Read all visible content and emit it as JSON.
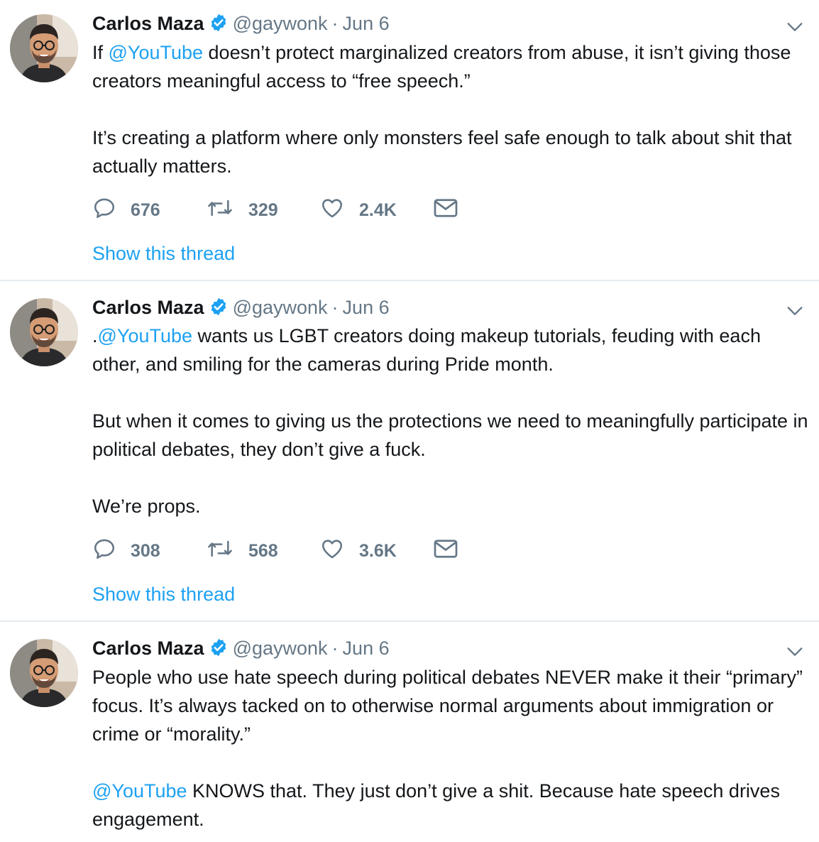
{
  "tweets": [
    {
      "name": "Carlos Maza",
      "handle": "@gaywonk",
      "separator": "·",
      "date": "Jun 6",
      "paragraphs": [
        [
          {
            "t": "If "
          },
          {
            "t": "@YouTube",
            "m": true
          },
          {
            "t": " doesn’t protect marginalized creators from abuse, it isn’t giving those creators meaningful access to “free speech.”"
          }
        ],
        [
          {
            "t": "It’s creating a platform where only monsters feel safe enough to talk about shit that actually matters."
          }
        ]
      ],
      "replies": "676",
      "retweets": "329",
      "likes": "2.4K",
      "show_thread": "Show this thread"
    },
    {
      "name": "Carlos Maza",
      "handle": "@gaywonk",
      "separator": "·",
      "date": "Jun 6",
      "paragraphs": [
        [
          {
            "t": "."
          },
          {
            "t": "@YouTube",
            "m": true
          },
          {
            "t": " wants us LGBT creators doing makeup tutorials, feuding with each other, and smiling for the cameras during Pride month."
          }
        ],
        [
          {
            "t": "But when it comes to giving us the protections we need to meaningfully participate in political debates, they don’t give a fuck."
          }
        ],
        [
          {
            "t": "We’re props."
          }
        ]
      ],
      "replies": "308",
      "retweets": "568",
      "likes": "3.6K",
      "show_thread": "Show this thread"
    },
    {
      "name": "Carlos Maza",
      "handle": "@gaywonk",
      "separator": "·",
      "date": "Jun 6",
      "paragraphs": [
        [
          {
            "t": "People who use hate speech during political debates NEVER make it their “primary” focus. It’s always tacked on to otherwise normal arguments about immigration or crime or “morality.”"
          }
        ],
        [
          {
            "t": "@YouTube",
            "m": true
          },
          {
            "t": " KNOWS that. They just don’t give a shit. Because hate speech drives engagement."
          }
        ]
      ]
    }
  ],
  "colors": {
    "link": "#1da1f2",
    "secondary": "#657786",
    "text": "#14171a",
    "divider": "#e6ecf0"
  },
  "icons": {
    "verified": "verified-badge-icon",
    "caret": "chevron-down-icon",
    "reply": "reply-icon",
    "retweet": "retweet-icon",
    "like": "heart-icon",
    "dm": "envelope-icon"
  }
}
